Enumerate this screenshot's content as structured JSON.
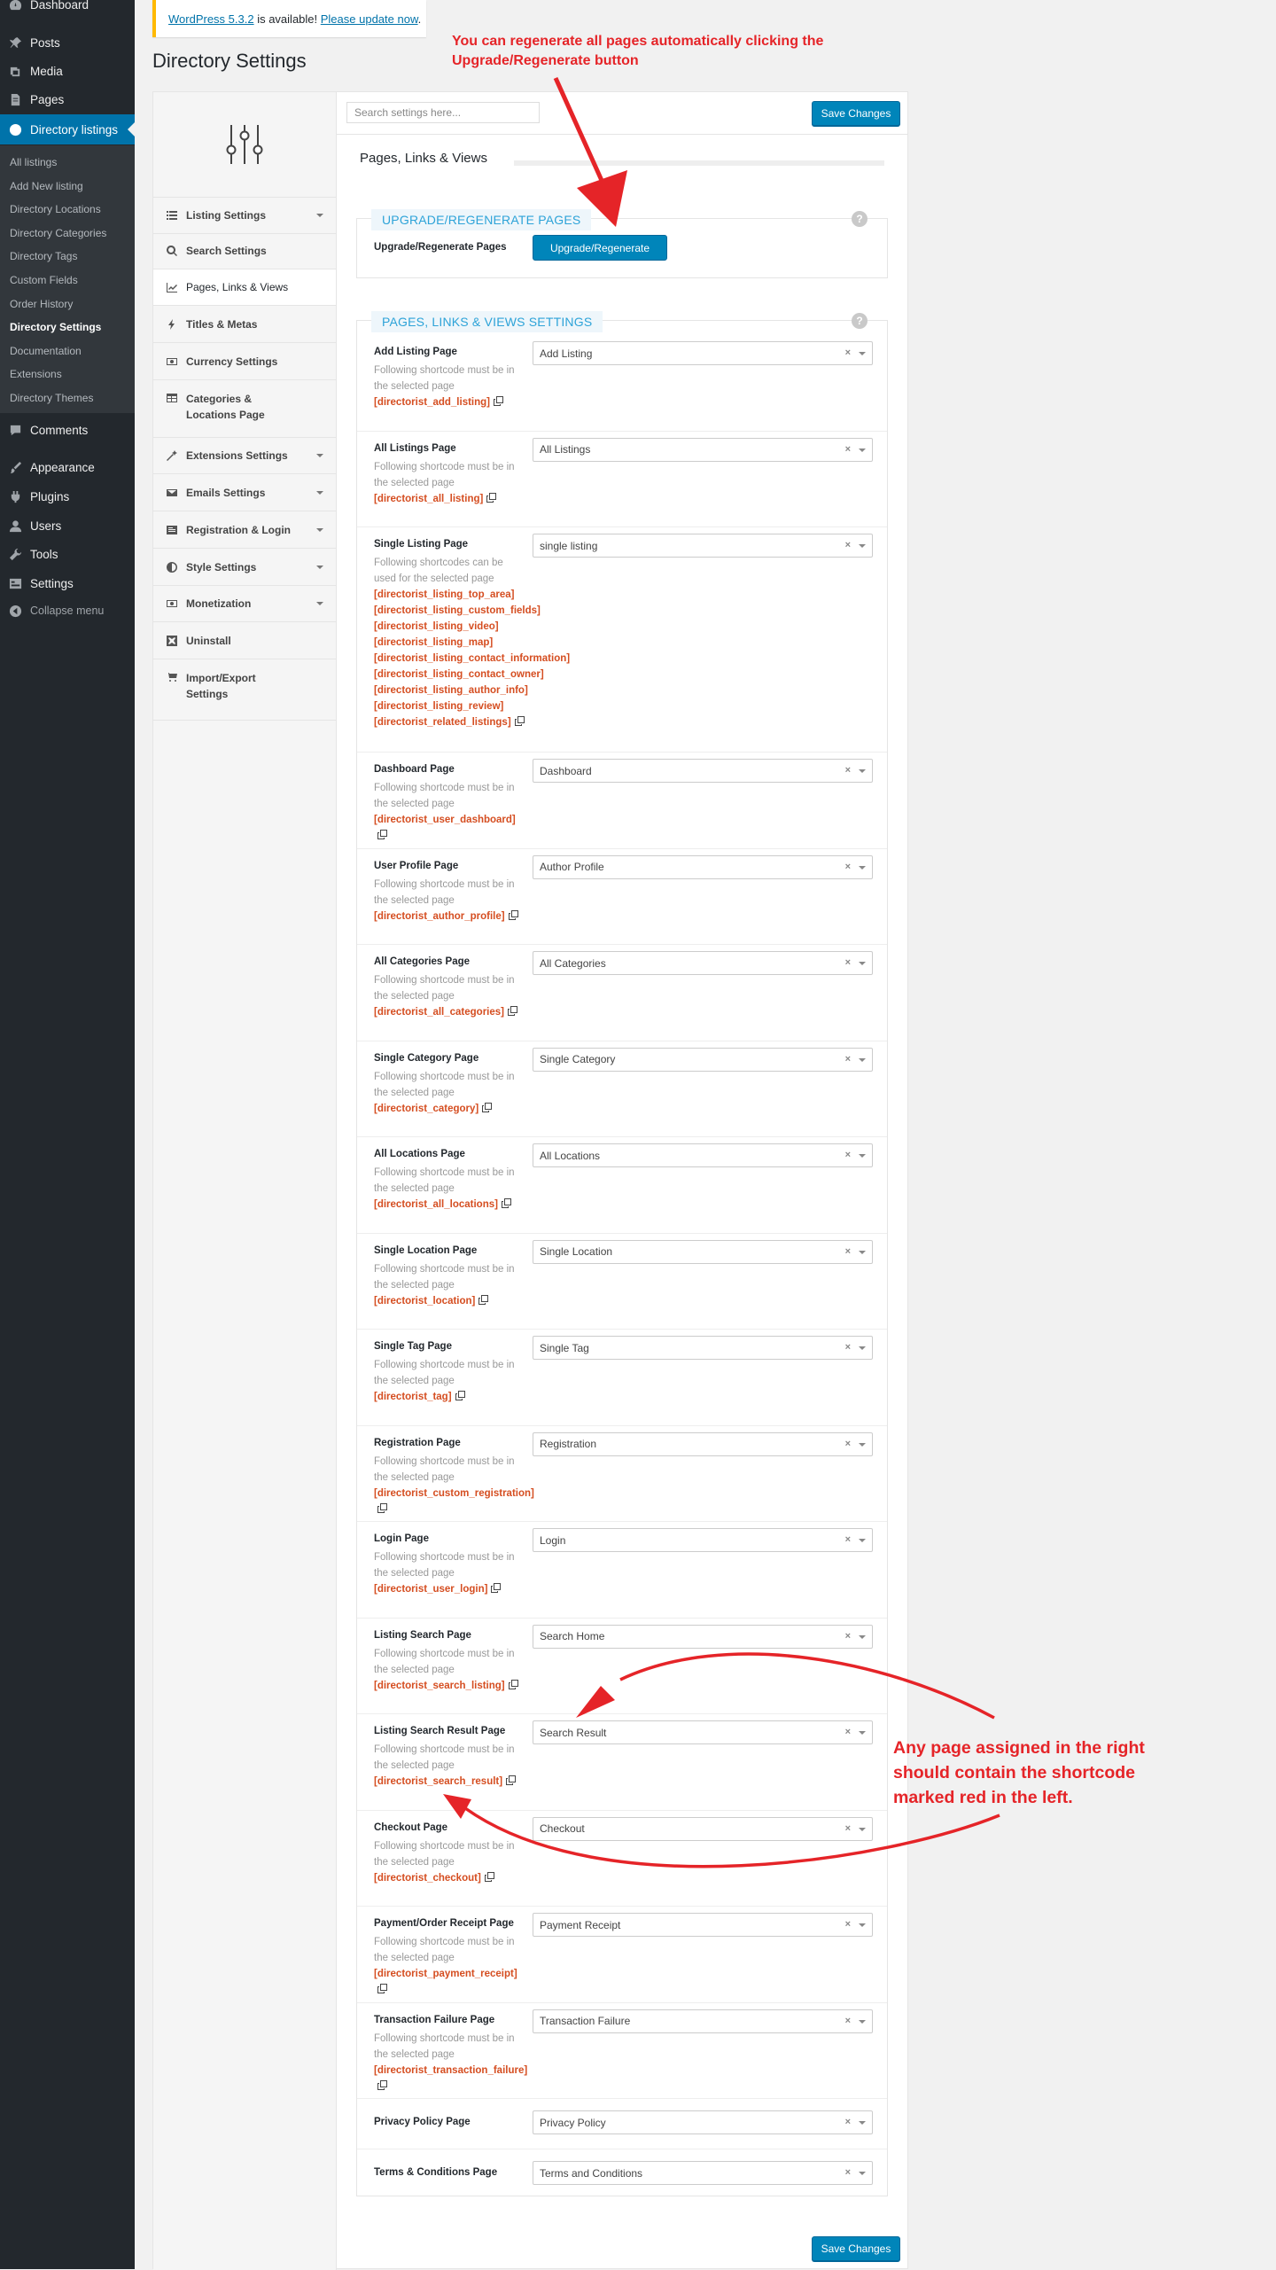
{
  "admin_menu": {
    "items": [
      {
        "label": "Dashboard",
        "icon": "dashboard-icon"
      },
      {
        "label": "Posts",
        "icon": "pin-icon"
      },
      {
        "label": "Media",
        "icon": "media-icon"
      },
      {
        "label": "Pages",
        "icon": "pages-icon"
      },
      {
        "label": "Directory listings",
        "icon": "directory-icon"
      },
      {
        "label": "Comments",
        "icon": "comment-icon"
      },
      {
        "label": "Appearance",
        "icon": "brush-icon"
      },
      {
        "label": "Plugins",
        "icon": "plugin-icon"
      },
      {
        "label": "Users",
        "icon": "users-icon"
      },
      {
        "label": "Tools",
        "icon": "tools-icon"
      },
      {
        "label": "Settings",
        "icon": "settings-icon"
      }
    ],
    "submenu": [
      "All listings",
      "Add New listing",
      "Directory Locations",
      "Directory Categories",
      "Directory Tags",
      "Custom Fields",
      "Order History",
      "Directory Settings",
      "Documentation",
      "Extensions",
      "Directory Themes"
    ],
    "collapse": "Collapse menu"
  },
  "notice": {
    "link": "WordPress 5.3.2",
    "middle": " is available! ",
    "update_link": "Please update now",
    "end": "."
  },
  "page_title": "Directory Settings",
  "annotations": {
    "top": "You can regenerate all pages automatically clicking the Upgrade/Regenerate button",
    "right": "Any page assigned in the right should contain the shortcode marked red in the left.",
    "color": "#e52428"
  },
  "search": {
    "placeholder": "Search settings here..."
  },
  "save_label": "Save Changes",
  "sidebar_nav": [
    {
      "label": "Listing Settings",
      "icon": "list-icon",
      "caret": true
    },
    {
      "label": "Search Settings",
      "icon": "search-icon",
      "caret": false
    },
    {
      "label": "Pages, Links & Views",
      "icon": "chart-icon",
      "caret": false
    },
    {
      "label": "Titles & Metas",
      "icon": "bolt-icon",
      "caret": false
    },
    {
      "label": "Currency Settings",
      "icon": "money-icon",
      "caret": false
    },
    {
      "label": "Categories & Locations Page",
      "icon": "table-icon",
      "caret": false
    },
    {
      "label": "Extensions Settings",
      "icon": "wand-icon",
      "caret": true
    },
    {
      "label": "Emails Settings",
      "icon": "envelope-icon",
      "caret": true
    },
    {
      "label": "Registration & Login",
      "icon": "registration-icon",
      "caret": true
    },
    {
      "label": "Style Settings",
      "icon": "adjust-icon",
      "caret": true
    },
    {
      "label": "Monetization",
      "icon": "money-icon",
      "caret": true
    },
    {
      "label": "Uninstall",
      "icon": "close-box-icon",
      "caret": false
    },
    {
      "label": "Import/Export Settings",
      "icon": "cart-icon",
      "caret": false
    }
  ],
  "section_title": "Pages, Links & Views",
  "regen_box": {
    "title": "UPGRADE/REGENERATE PAGES",
    "row_label": "Upgrade/Regenerate Pages",
    "button": "Upgrade/Regenerate"
  },
  "settings_box": {
    "title": "PAGES, LINKS & VIEWS SETTINGS",
    "desc_single": "Following shortcode must be in the selected page",
    "desc_multi": "Following shortcodes can be used for the selected page",
    "rows": [
      {
        "label": "Add Listing Page",
        "value": "Add Listing",
        "shortcodes": [
          "[directorist_add_listing]"
        ]
      },
      {
        "label": "All Listings Page",
        "value": "All Listings",
        "shortcodes": [
          "[directorist_all_listing]"
        ]
      },
      {
        "label": "Single Listing Page",
        "value": "single listing",
        "multi": true,
        "shortcodes": [
          "[directorist_listing_top_area]",
          "[directorist_listing_custom_fields]",
          "[directorist_listing_video]",
          "[directorist_listing_map]",
          "[directorist_listing_contact_information]",
          "[directorist_listing_contact_owner]",
          "[directorist_listing_author_info]",
          "[directorist_listing_review]",
          "[directorist_related_listings]"
        ]
      },
      {
        "label": "Dashboard Page",
        "value": "Dashboard",
        "shortcodes": [
          "[directorist_user_dashboard]"
        ]
      },
      {
        "label": "User Profile Page",
        "value": "Author Profile",
        "shortcodes": [
          "[directorist_author_profile]"
        ]
      },
      {
        "label": "All Categories Page",
        "value": "All Categories",
        "shortcodes": [
          "[directorist_all_categories]"
        ]
      },
      {
        "label": "Single Category Page",
        "value": "Single Category",
        "shortcodes": [
          "[directorist_category]"
        ]
      },
      {
        "label": "All Locations Page",
        "value": "All Locations",
        "shortcodes": [
          "[directorist_all_locations]"
        ]
      },
      {
        "label": "Single Location Page",
        "value": "Single Location",
        "shortcodes": [
          "[directorist_location]"
        ]
      },
      {
        "label": "Single Tag Page",
        "value": "Single Tag",
        "shortcodes": [
          "[directorist_tag]"
        ]
      },
      {
        "label": "Registration Page",
        "value": "Registration",
        "shortcodes": [
          "[directorist_custom_registration]"
        ]
      },
      {
        "label": "Login Page",
        "value": "Login",
        "shortcodes": [
          "[directorist_user_login]"
        ]
      },
      {
        "label": "Listing Search Page",
        "value": "Search Home",
        "shortcodes": [
          "[directorist_search_listing]"
        ]
      },
      {
        "label": "Listing Search Result Page",
        "value": "Search Result",
        "shortcodes": [
          "[directorist_search_result]"
        ]
      },
      {
        "label": "Checkout Page",
        "value": "Checkout",
        "shortcodes": [
          "[directorist_checkout]"
        ]
      },
      {
        "label": "Payment/Order Receipt Page",
        "value": "Payment Receipt",
        "shortcodes": [
          "[directorist_payment_receipt]"
        ]
      },
      {
        "label": "Transaction Failure Page",
        "value": "Transaction Failure",
        "shortcodes": [
          "[directorist_transaction_failure]"
        ]
      },
      {
        "label": "Privacy Policy Page",
        "value": "Privacy Policy",
        "shortcodes": []
      },
      {
        "label": "Terms & Conditions Page",
        "value": "Terms and Conditions",
        "shortcodes": []
      }
    ]
  }
}
